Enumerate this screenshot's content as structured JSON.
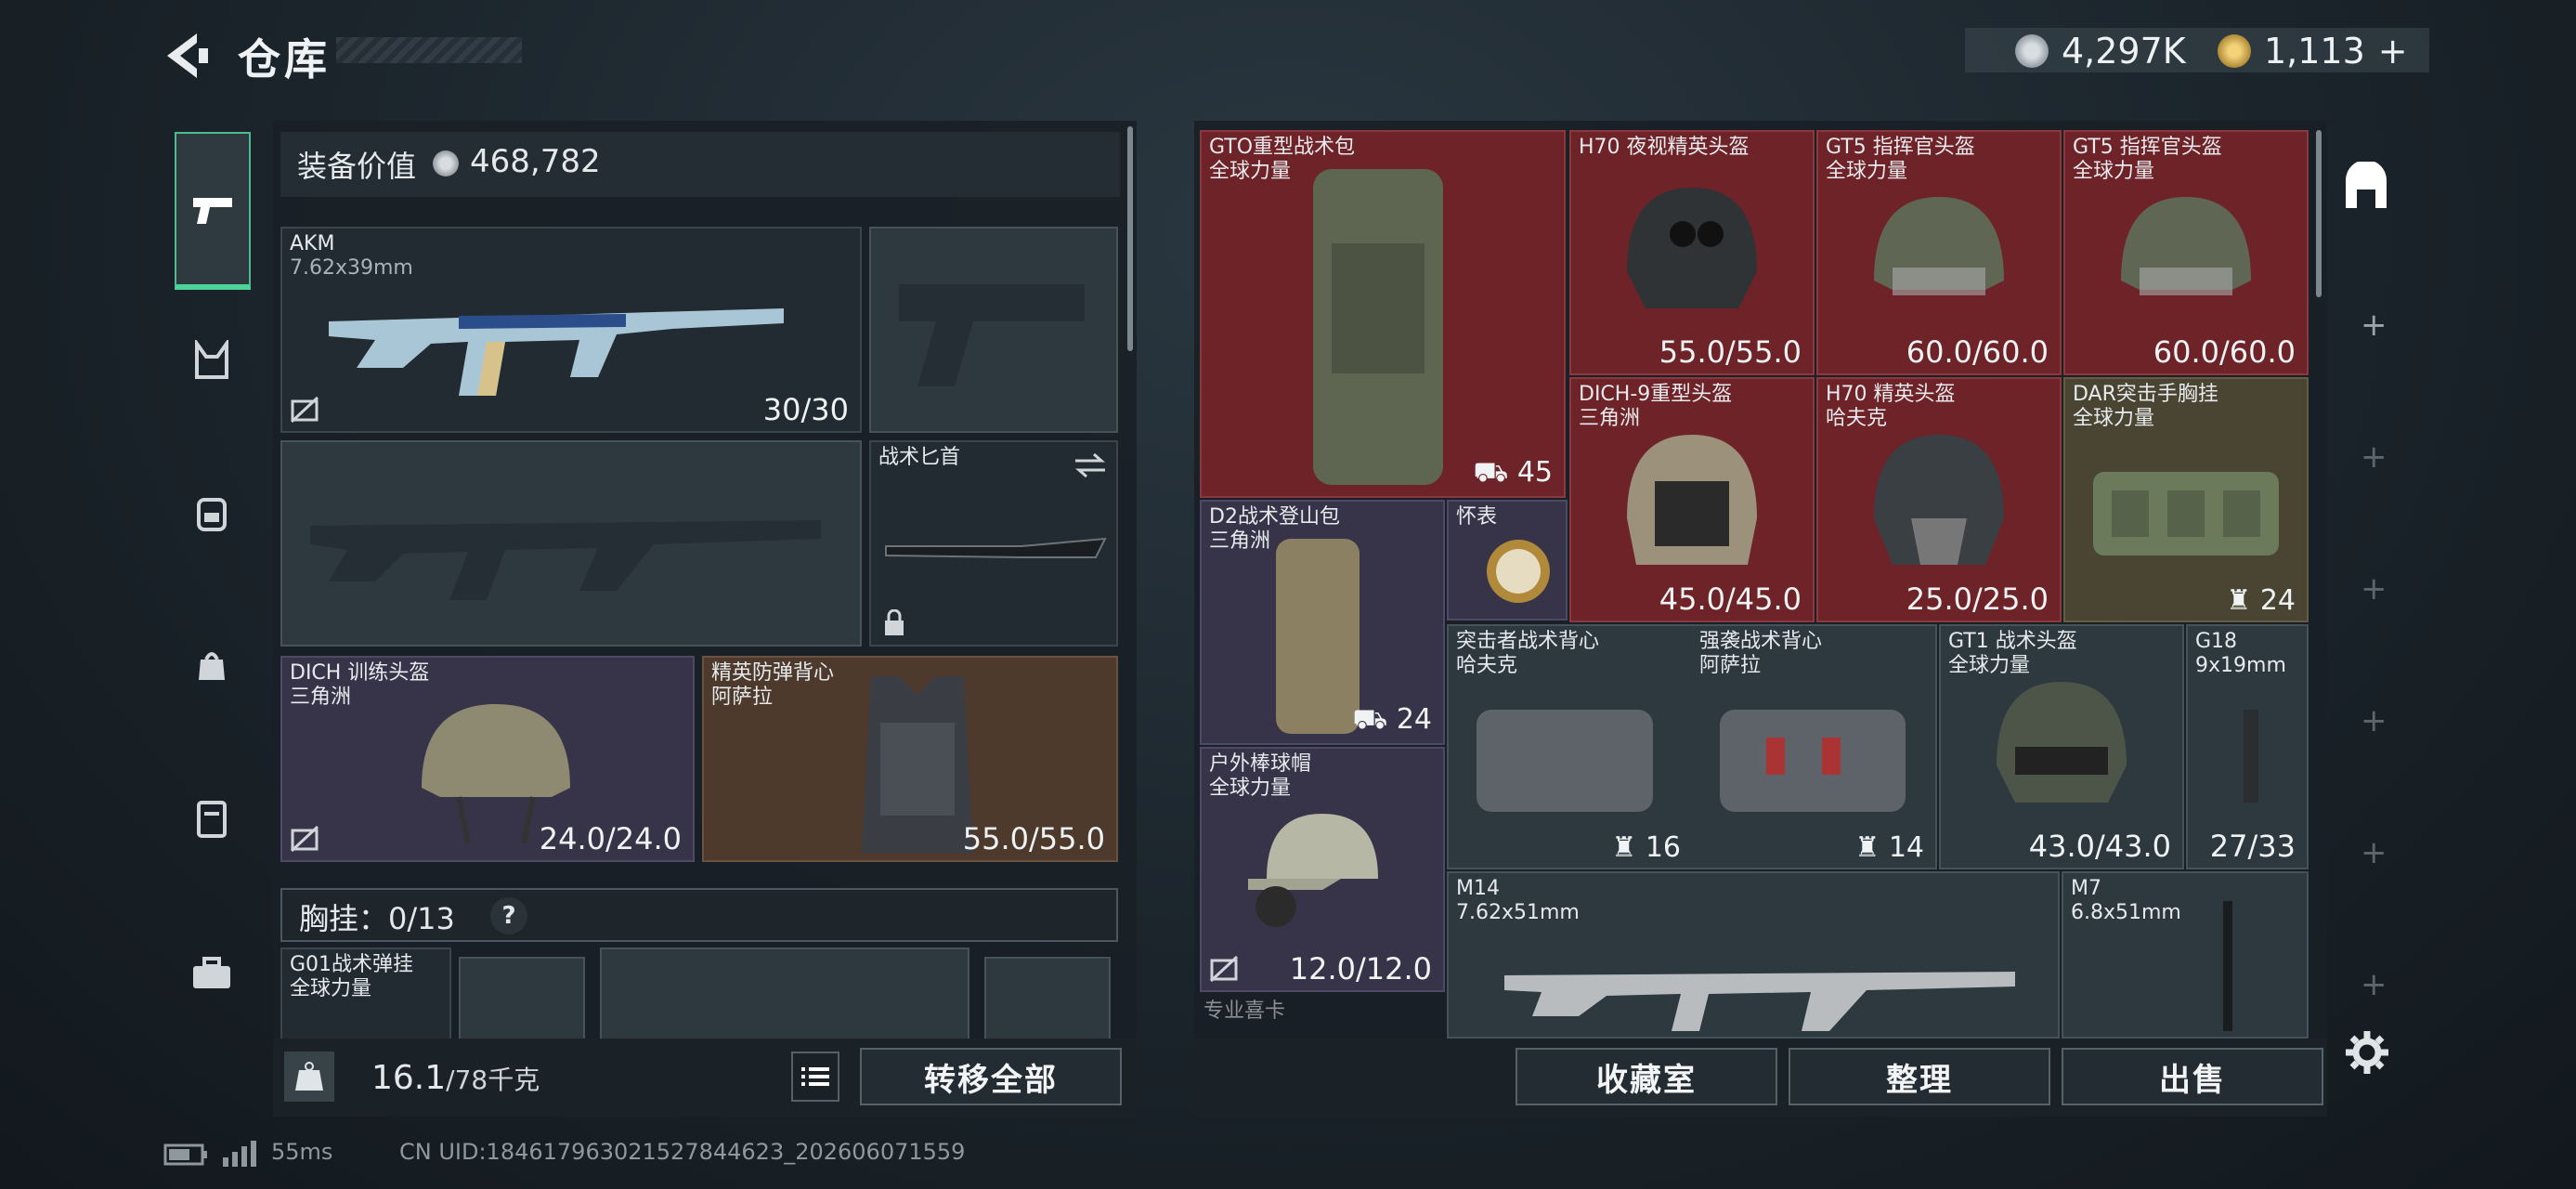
{
  "header": {
    "title": "仓库",
    "currency1": "4,297K",
    "currency2": "1,113",
    "currency2_plus": "+"
  },
  "left": {
    "equip_value_label": "装备价值",
    "equip_value": "468,782",
    "primary": {
      "name": "AKM",
      "sub": "7.62x39mm",
      "ammo": "30/30"
    },
    "melee": {
      "name": "战术匕首"
    },
    "helmet": {
      "name": "DICH 训练头盔",
      "sub": "三角洲",
      "dur": "24.0/24.0"
    },
    "armor": {
      "name": "精英防弹背心",
      "sub": "阿萨拉",
      "dur": "55.0/55.0"
    },
    "chest_label": "胸挂：",
    "chest_cap": "0/13",
    "chest_help": "?",
    "chest_item": {
      "name": "G01战术弹挂",
      "sub": "全球力量"
    },
    "weight": "16.1",
    "weight_cap": "/78千克",
    "transfer_all": "转移全部"
  },
  "right": {
    "items": [
      {
        "name": "GTO重型战术包",
        "sub": "全球力量",
        "val": "45"
      },
      {
        "name": "H70 夜视精英头盔",
        "sub": "",
        "val": "55.0/55.0"
      },
      {
        "name": "GT5 指挥官头盔",
        "sub": "全球力量",
        "val": "60.0/60.0"
      },
      {
        "name": "GT5 指挥官头盔",
        "sub": "全球力量",
        "val": "60.0/60.0"
      },
      {
        "name": "DICH-9重型头盔",
        "sub": "三角洲",
        "val": "45.0/45.0"
      },
      {
        "name": "H70 精英头盔",
        "sub": "哈夫克",
        "val": "25.0/25.0"
      },
      {
        "name": "DAR突击手胸挂",
        "sub": "全球力量",
        "val": "24"
      },
      {
        "name": "D2战术登山包",
        "sub": "三角洲",
        "val": "24"
      },
      {
        "name": "怀表",
        "sub": "",
        "val": ""
      },
      {
        "name": "突击者战术背心",
        "sub": "哈夫克",
        "val": "16"
      },
      {
        "name": "强袭战术背心",
        "sub": "阿萨拉",
        "val": "14"
      },
      {
        "name": "GT1 战术头盔",
        "sub": "全球力量",
        "val": "43.0/43.0"
      },
      {
        "name": "G18",
        "sub": "9x19mm",
        "val": "27/33"
      },
      {
        "name": "户外棒球帽",
        "sub": "全球力量",
        "val": "12.0/12.0"
      },
      {
        "name": "M14",
        "sub": "7.62x51mm",
        "val": ""
      },
      {
        "name": "M7",
        "sub": "6.8x51mm",
        "val": ""
      },
      {
        "name": "专业喜卡",
        "sub": "",
        "val": ""
      }
    ],
    "btn_collection": "收藏室",
    "btn_sort": "整理",
    "btn_sell": "出售"
  },
  "footer": {
    "ping": "55ms",
    "uid": "CN UID:1846179630215278446​23_202606071559"
  },
  "colors": {
    "accent": "#4dd39a",
    "red_cell": "#6e2328",
    "brown_cell": "#4d3a2c",
    "purple_cell": "#37344a"
  }
}
